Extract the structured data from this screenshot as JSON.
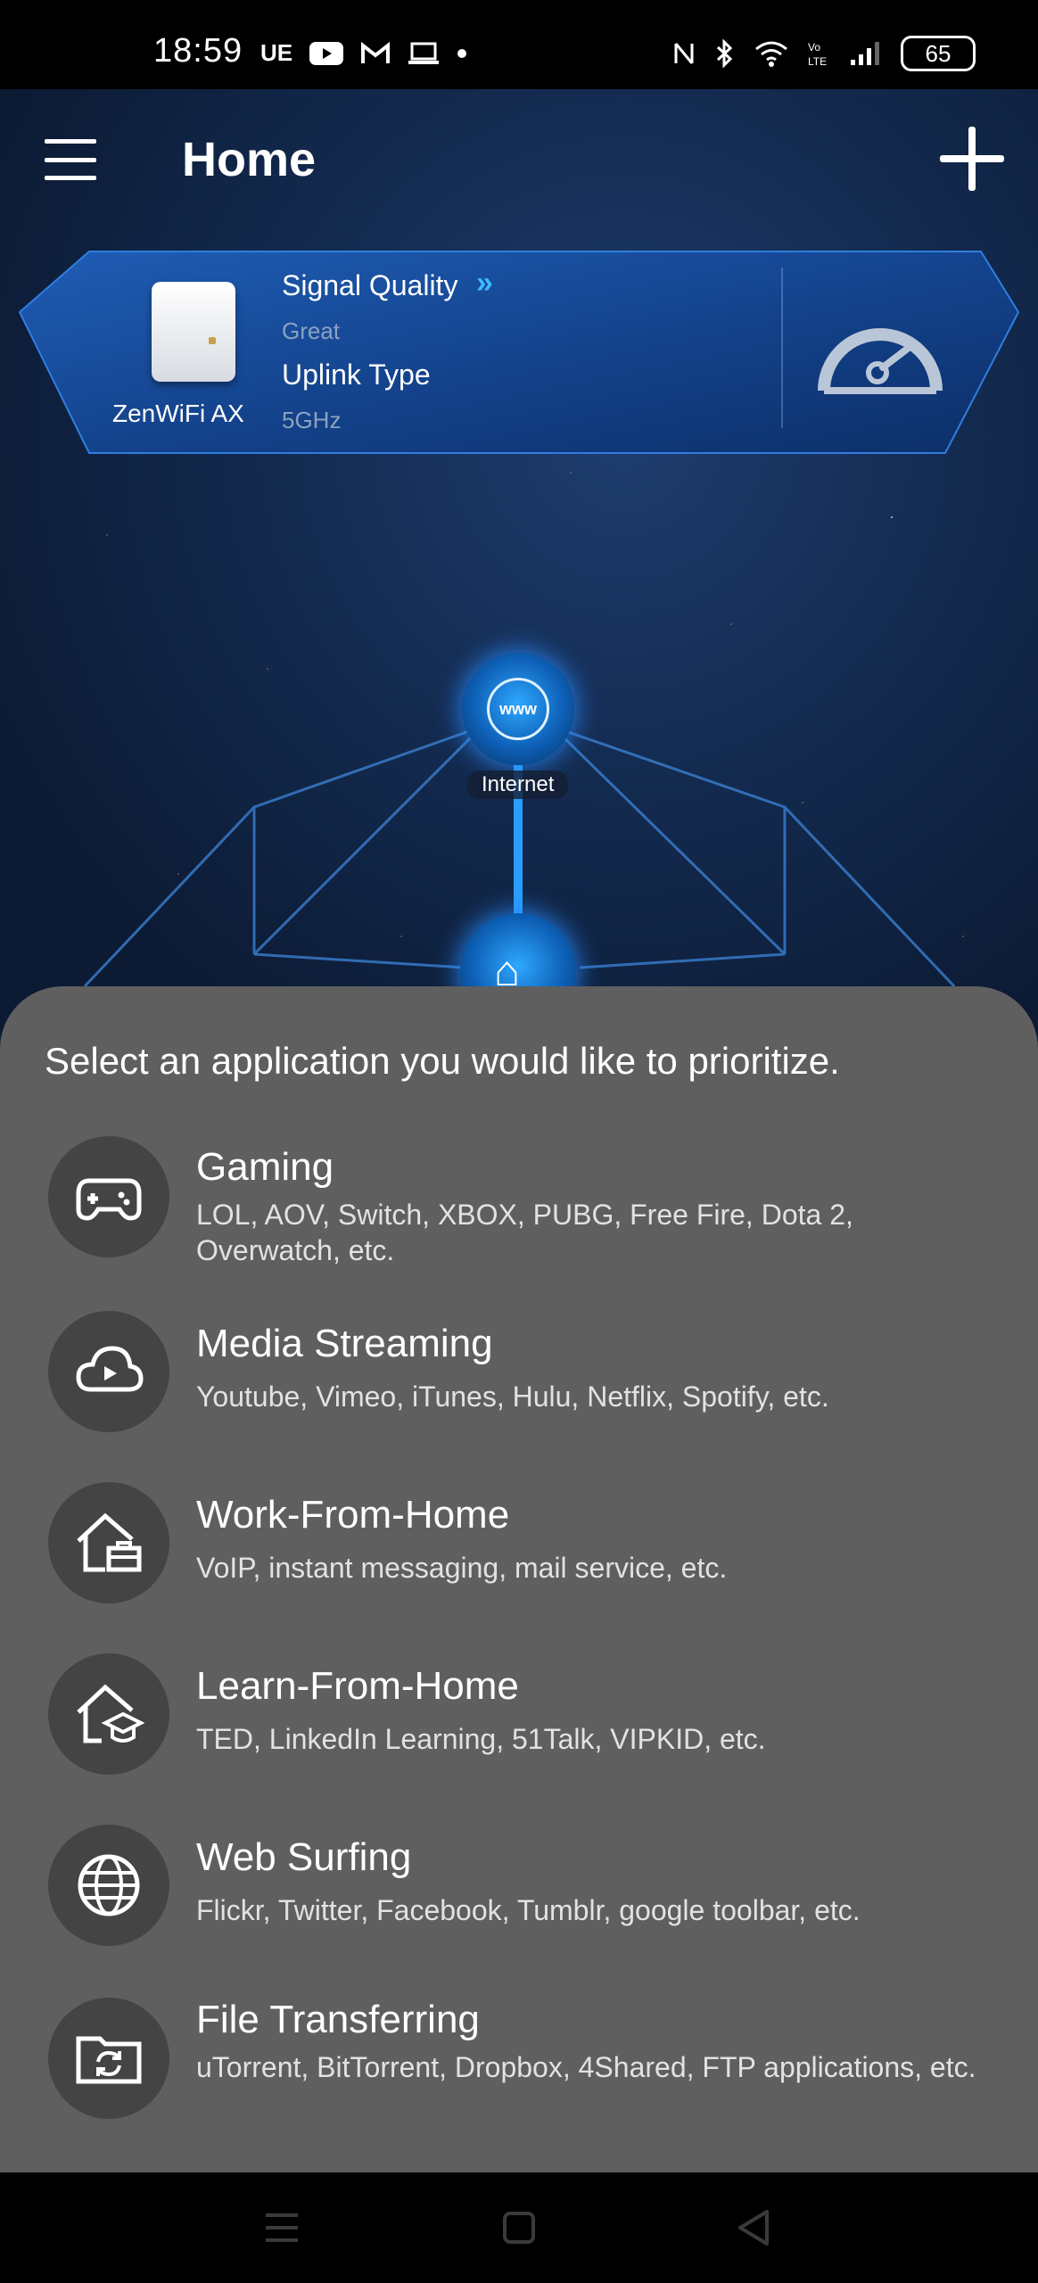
{
  "status_bar": {
    "time": "18:59",
    "left_icons": [
      "UE",
      "youtube-icon",
      "gmail-icon",
      "laptop-icon",
      "dot"
    ],
    "battery": "65"
  },
  "header": {
    "title": "Home"
  },
  "device": {
    "name": "ZenWiFi AX",
    "signal_label": "Signal Quality",
    "signal_arrows": "»",
    "signal_value": "Great",
    "uplink_label": "Uplink Type",
    "uplink_value": "5GHz"
  },
  "network": {
    "internet_label": "Internet",
    "internet_icon_text": "www"
  },
  "sheet": {
    "title": "Select an application you would like to prioritize.",
    "items": [
      {
        "name": "Gaming",
        "desc": "LOL, AOV, Switch, XBOX, PUBG, Free Fire, Dota 2, Overwatch, etc.",
        "icon": "gamepad-icon"
      },
      {
        "name": "Media Streaming",
        "desc": "Youtube, Vimeo, iTunes, Hulu, Netflix, Spotify, etc.",
        "icon": "cloud-play-icon"
      },
      {
        "name": "Work-From-Home",
        "desc": "VoIP, instant messaging, mail service, etc.",
        "icon": "home-briefcase-icon"
      },
      {
        "name": "Learn-From-Home",
        "desc": "TED, LinkedIn Learning, 51Talk, VIPKID, etc.",
        "icon": "home-graduation-icon"
      },
      {
        "name": "Web Surfing",
        "desc": "Flickr, Twitter, Facebook, Tumblr, google toolbar, etc.",
        "icon": "globe-icon"
      },
      {
        "name": "File Transferring",
        "desc": "uTorrent, BitTorrent, Dropbox, 4Shared, FTP applications, etc.",
        "icon": "folder-sync-icon"
      }
    ]
  },
  "colors": {
    "accent": "#3fb8ff",
    "sheet_bg": "#5f5f5f",
    "icon_circle": "#444444"
  }
}
